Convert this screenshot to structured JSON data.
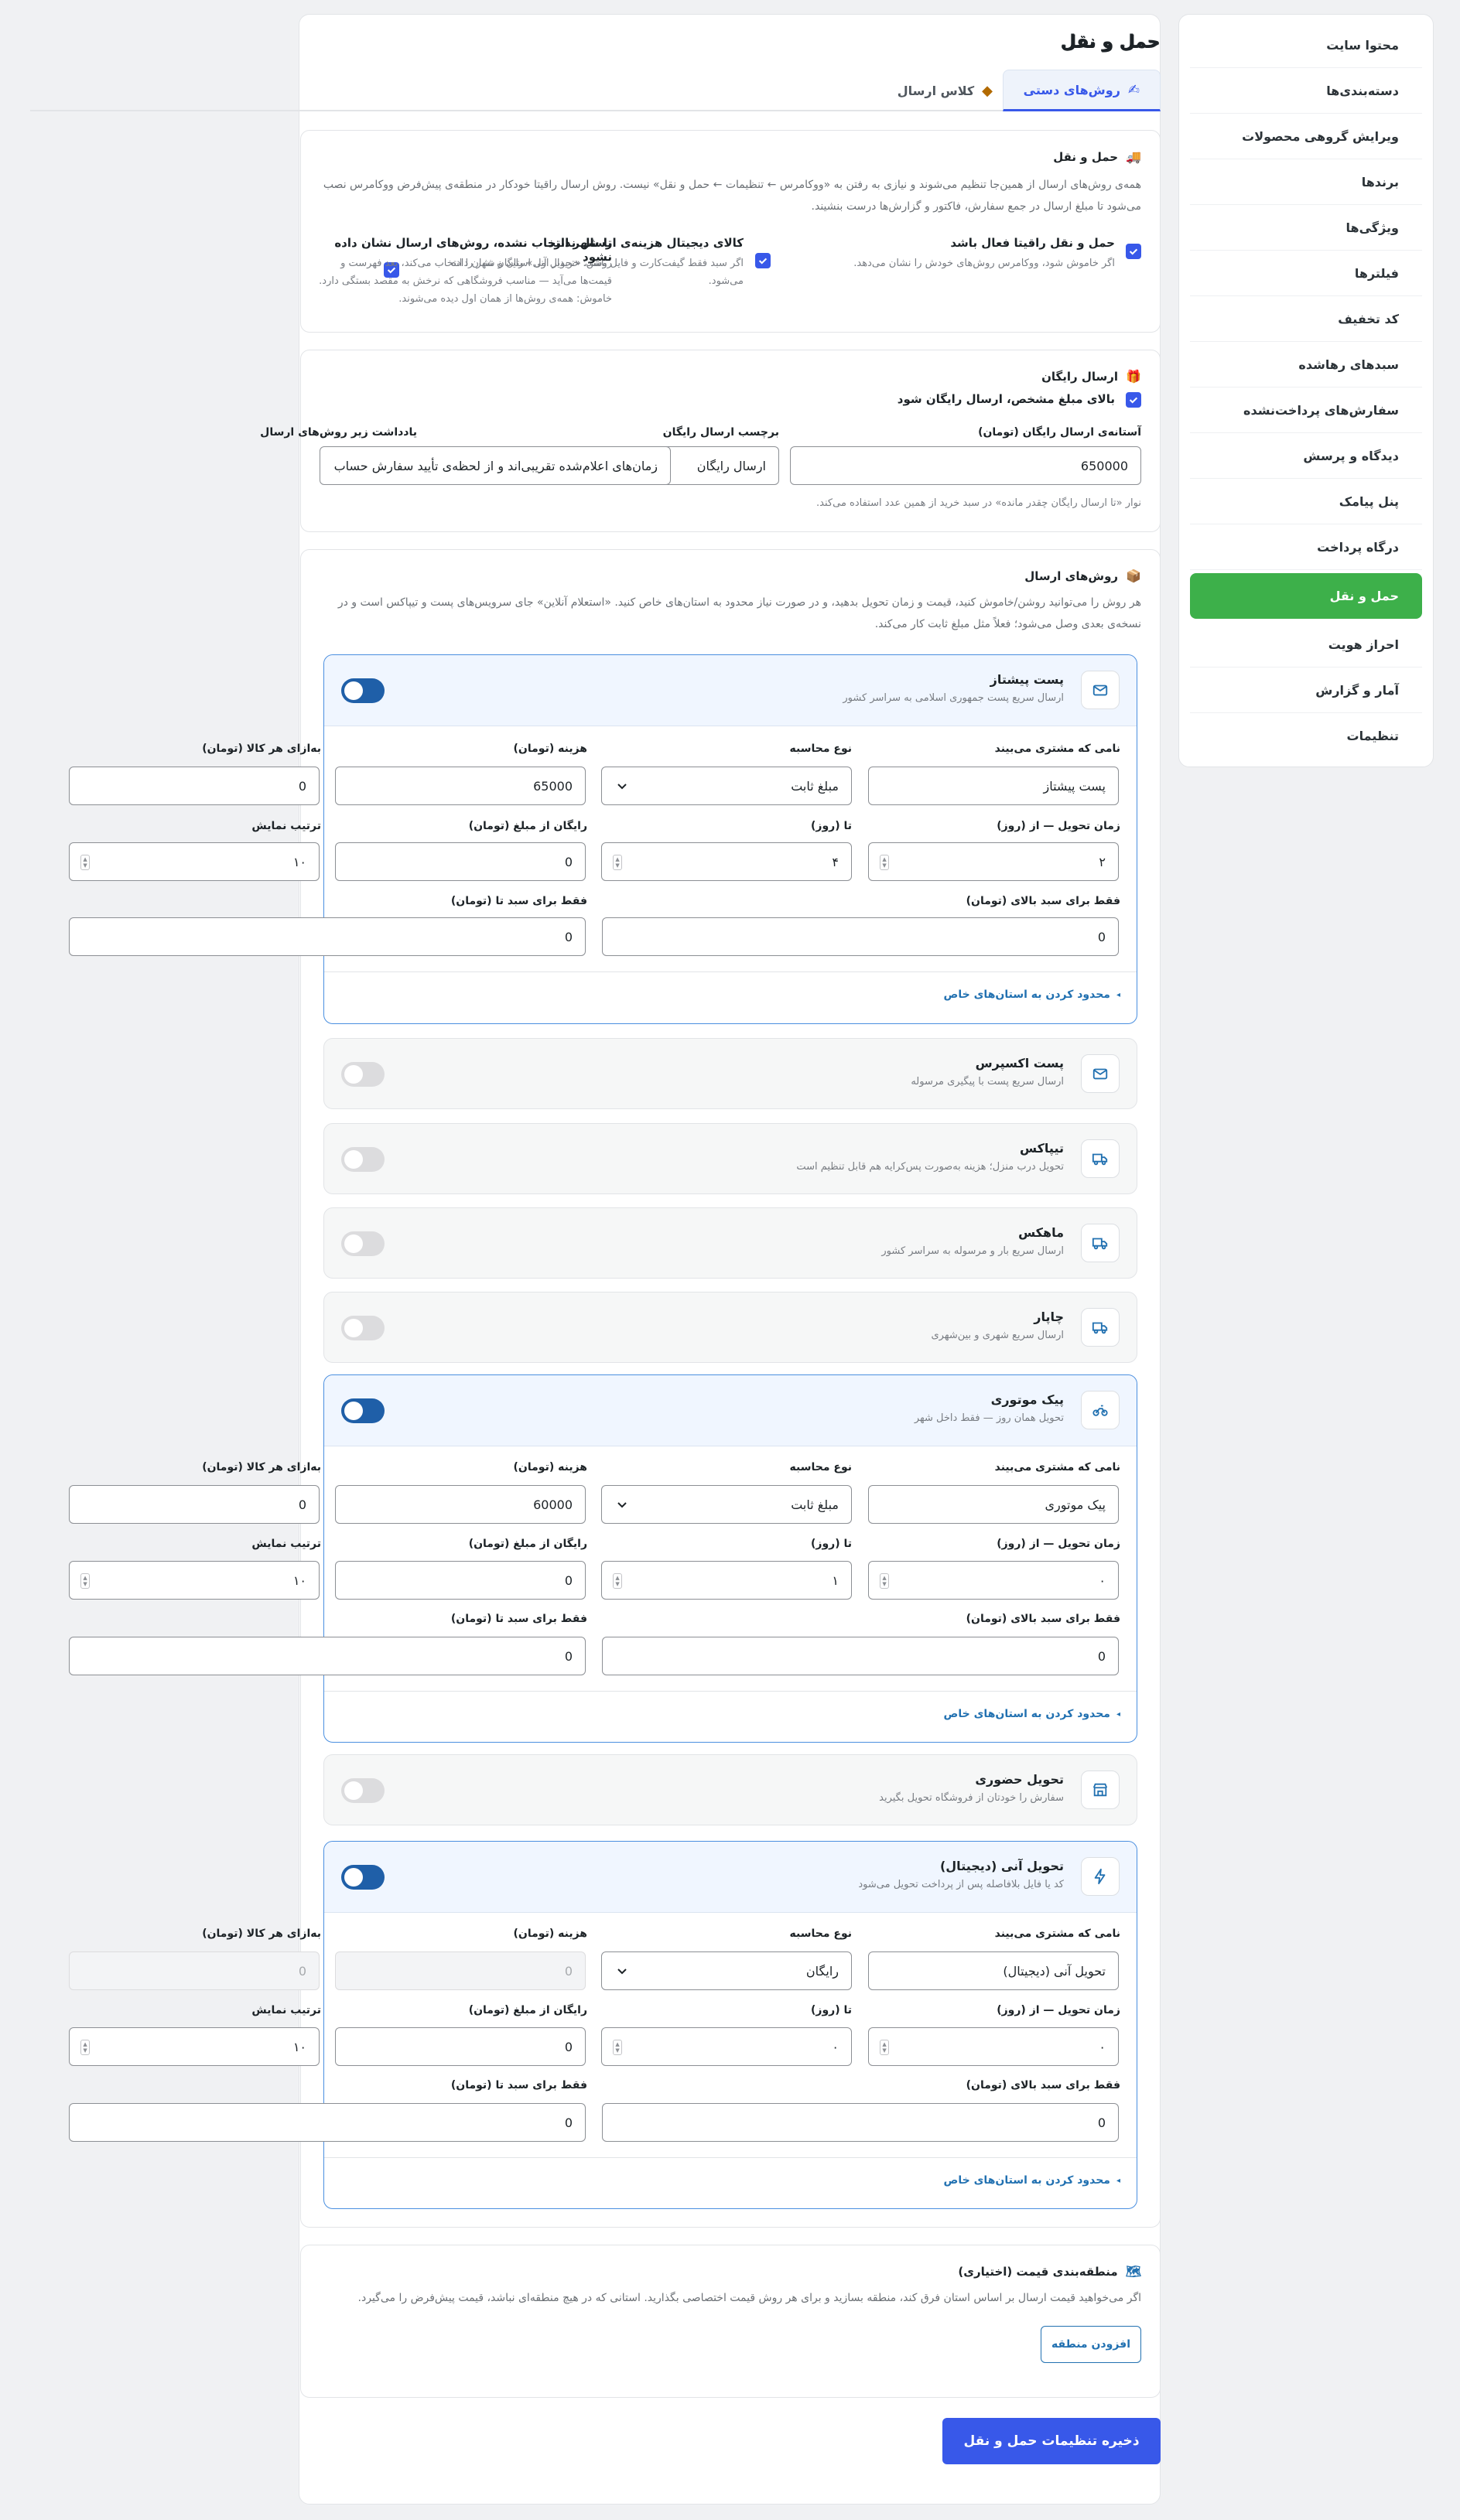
{
  "sidebar": {
    "items": [
      {
        "label": "محتوا سایت",
        "active": false
      },
      {
        "label": "دسته‌بندی‌ها",
        "active": false
      },
      {
        "label": "ویرایش گروهی محصولات",
        "active": false
      },
      {
        "label": "برندها",
        "active": false
      },
      {
        "label": "ویژگی‌ها",
        "active": false
      },
      {
        "label": "فیلترها",
        "active": false
      },
      {
        "label": "کد تخفیف",
        "active": false
      },
      {
        "label": "سبدهای رهاشده",
        "active": false
      },
      {
        "label": "سفارش‌های پرداخت‌نشده",
        "active": false
      },
      {
        "label": "دیدگاه و پرسش",
        "active": false
      },
      {
        "label": "پنل پیامک",
        "active": false
      },
      {
        "label": "درگاه پرداخت",
        "active": false
      },
      {
        "label": "حمل و نقل",
        "active": true
      },
      {
        "label": "احراز هویت",
        "active": false
      },
      {
        "label": "آمار و گزارش",
        "active": false
      },
      {
        "label": "تنظیمات",
        "active": false
      }
    ]
  },
  "page": {
    "title": "حمل و نقل"
  },
  "tabs": [
    {
      "label": "روش‌های دستی",
      "icon": "hand-icon",
      "active": true
    },
    {
      "label": "کلاس ارسال",
      "icon": "box-icon",
      "active": false
    }
  ],
  "shipping": {
    "title": "حمل و نقل",
    "description": "همه‌ی روش‌های ارسال از همین‌جا تنظیم می‌شوند و نیازی به رفتن به «ووکامرس ← تنظیمات ← حمل و نقل» نیست. روش ارسال راقیتا خودکار در منطقه‌ی پیش‌فرض ووکامرس نصب می‌شود تا مبلغ ارسال در جمع سفارش، فاکتور و گزارش‌ها درست بنشیند.",
    "options": [
      {
        "title": "حمل و نقل راقیتا فعال باشد",
        "desc": "اگر خاموش شود، ووکامرس روش‌های خودش را نشان می‌دهد.",
        "checked": true
      },
      {
        "title": "کالای دیجیتال هزینه‌ی ارسال ندارد",
        "desc": "اگر سبد فقط گیفت‌کارت و فایل باشد، «تحویل آنی» رایگان نشان داده می‌شود.",
        "checked": true
      },
      {
        "title": "تا شهر انتخاب نشده، روش‌های ارسال نشان داده نشود",
        "desc": "روشن: خریدار اول استان و شهر را انتخاب می‌کند، بعد فهرست و قیمت‌ها می‌آید — مناسب فروشگاهی که نرخش به مقصد بستگی دارد. خاموش: همه‌ی روش‌ها از همان اول دیده می‌شوند.",
        "checked": true
      }
    ]
  },
  "free_shipping": {
    "title": "ارسال رایگان",
    "checkbox_label": "بالای مبلغ مشخص، ارسال رایگان شود",
    "checked": true,
    "threshold_label": "آستانه‌ی ارسال رایگان (تومان)",
    "threshold_value": "650000",
    "tag_label": "برچسب ارسال رایگان",
    "tag_value": "ارسال رایگان",
    "note_label": "یادداشت زیر روش‌های ارسال",
    "note_value": "زمان‌های اعلام‌شده تقریبی‌اند و از لحظه‌ی تأیید سفارش حساب",
    "hint": "نوار «تا ارسال رایگان چقدر مانده» در سبد خرید از همین عدد استفاده می‌کند."
  },
  "methods_section": {
    "title": "روش‌های ارسال",
    "description": "هر روش را می‌توانید روشن/خاموش کنید، قیمت و زمان تحویل بدهید، و در صورت نیاز محدود به استان‌های خاص کنید. «استعلام آنلاین» جای سرویس‌های پست و تیپاکس است و در نسخه‌ی بعدی وصل می‌شود؛ فعلاً مثل مبلغ ثابت کار می‌کند."
  },
  "field_labels": {
    "customer_name": "نامی که مشتری می‌بیند",
    "calc_type": "نوع محاسبه",
    "cost": "هزینه (تومان)",
    "per_item": "به‌ازای هر کالا (تومان)",
    "delivery_from": "زمان تحویل — از (روز)",
    "delivery_to": "تا (روز)",
    "free_from": "رایگان از مبلغ (تومان)",
    "sort_order": "ترتیب نمایش",
    "only_above": "فقط برای سبد بالای (تومان)",
    "only_below": "فقط برای سبد تا (تومان)",
    "limit_link": "محدود کردن به استان‌های خاص"
  },
  "methods": [
    {
      "title": "پست پیشتاز",
      "subtitle": "ارسال سریع پست جمهوری اسلامی به سراسر کشور",
      "icon": "envelope-icon",
      "enabled": true,
      "fields": {
        "customer_name": "پست پیشتاز",
        "calc_type": "مبلغ ثابت",
        "cost": "65000",
        "per_item": "0",
        "delivery_from": "۲",
        "delivery_to": "۴",
        "free_from": "0",
        "sort_order": "۱۰",
        "only_above": "0",
        "only_below": "0"
      }
    },
    {
      "title": "پست اکسپرس",
      "subtitle": "ارسال سریع پست با پیگیری مرسوله",
      "icon": "envelope-icon",
      "enabled": false
    },
    {
      "title": "تیپاکس",
      "subtitle": "تحویل درب منزل؛ هزینه به‌صورت پس‌کرایه هم قابل تنظیم است",
      "icon": "truck-icon",
      "enabled": false
    },
    {
      "title": "ماهکس",
      "subtitle": "ارسال سریع بار و مرسوله به سراسر کشور",
      "icon": "truck-icon",
      "enabled": false
    },
    {
      "title": "چاپار",
      "subtitle": "ارسال سریع شهری و بین‌شهری",
      "icon": "truck-icon",
      "enabled": false
    },
    {
      "title": "پیک موتوری",
      "subtitle": "تحویل همان روز — فقط داخل شهر",
      "icon": "motorbike-icon",
      "enabled": true,
      "fields": {
        "customer_name": "پیک موتوری",
        "calc_type": "مبلغ ثابت",
        "cost": "60000",
        "per_item": "0",
        "delivery_from": "۰",
        "delivery_to": "۱",
        "free_from": "0",
        "sort_order": "۱۰",
        "only_above": "0",
        "only_below": "0"
      }
    },
    {
      "title": "تحویل حضوری",
      "subtitle": "سفارش را خودتان از فروشگاه تحویل بگیرید",
      "icon": "store-icon",
      "enabled": false
    },
    {
      "title": "تحویل آنی (دیجیتال)",
      "subtitle": "کد یا فایل بلافاصله پس از پرداخت تحویل می‌شود",
      "icon": "bolt-icon",
      "enabled": true,
      "fields": {
        "customer_name": "تحویل آنی (دیجیتال)",
        "calc_type": "رایگان",
        "cost": "0",
        "per_item": "0",
        "delivery_from": "۰",
        "delivery_to": "۰",
        "free_from": "0",
        "sort_order": "۱۰",
        "only_above": "0",
        "only_below": "0"
      }
    }
  ],
  "zones": {
    "title": "منطقه‌بندی قیمت (اختیاری)",
    "description": "اگر می‌خواهید قیمت ارسال بر اساس استان فرق کند، منطقه بسازید و برای هر روش قیمت اختصاصی بگذارید. استانی که در هیچ منطقه‌ای نباشد، قیمت پیش‌فرض را می‌گیرد.",
    "add_button": "افزودن منطقه"
  },
  "save_button": "ذخیره تنظیمات حمل و نقل",
  "colors": {
    "accent": "#3858e9",
    "active_nav": "#3db04a",
    "toggle_on": "#1f5fa8",
    "link": "#2271b1"
  }
}
